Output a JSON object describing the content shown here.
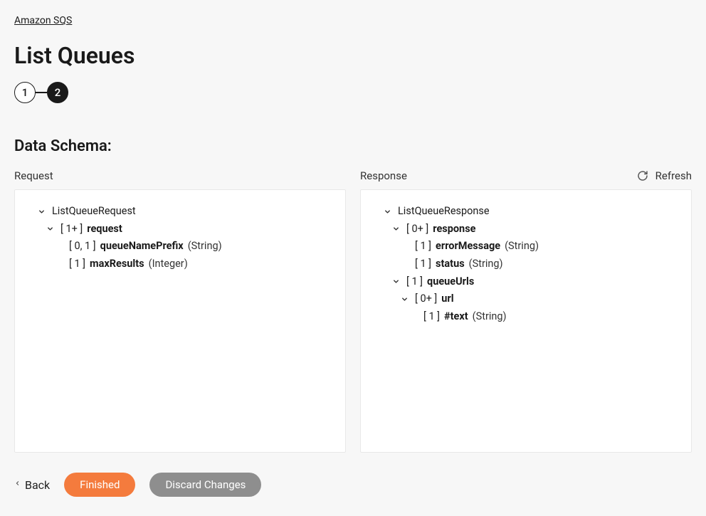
{
  "breadcrumb": "Amazon SQS",
  "page_title": "List Queues",
  "stepper": {
    "step1": "1",
    "step2": "2"
  },
  "section_title": "Data Schema:",
  "refresh_label": "Refresh",
  "panels": {
    "request": {
      "header": "Request",
      "root": "ListQueueRequest",
      "items": {
        "request_card": "[ 1+ ]",
        "request_name": "request",
        "qnp_card": "[ 0, 1 ]",
        "qnp_name": "queueNamePrefix",
        "qnp_type": "(String)",
        "mr_card": "[ 1 ]",
        "mr_name": "maxResults",
        "mr_type": "(Integer)"
      }
    },
    "response": {
      "header": "Response",
      "root": "ListQueueResponse",
      "items": {
        "response_card": "[ 0+ ]",
        "response_name": "response",
        "err_card": "[ 1 ]",
        "err_name": "errorMessage",
        "err_type": "(String)",
        "status_card": "[ 1 ]",
        "status_name": "status",
        "status_type": "(String)",
        "qurls_card": "[ 1 ]",
        "qurls_name": "queueUrls",
        "url_card": "[ 0+ ]",
        "url_name": "url",
        "text_card": "[ 1 ]",
        "text_name": "#text",
        "text_type": "(String)"
      }
    }
  },
  "footer": {
    "back": "Back",
    "finished": "Finished",
    "discard": "Discard Changes"
  }
}
